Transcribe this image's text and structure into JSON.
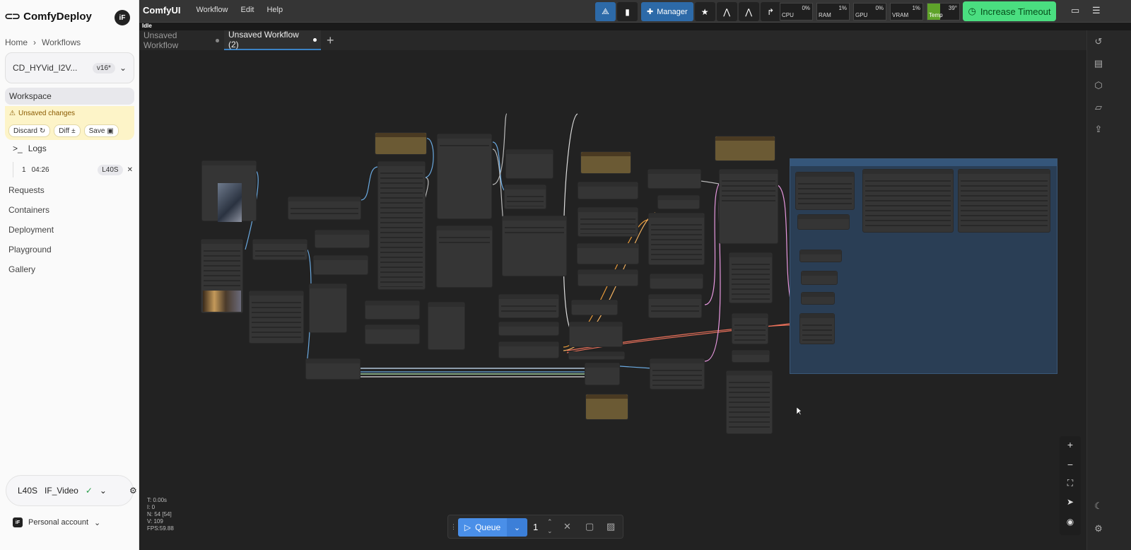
{
  "sidebar": {
    "brand": "ComfyDeploy",
    "avatar": "iF",
    "breadcrumb": [
      "Home",
      "Workflows"
    ],
    "workflow_name": "CD_HYVid_I2V...",
    "workflow_version": "v16*",
    "workspace_label": "Workspace",
    "unsaved_label": "Unsaved changes",
    "discard_label": "Discard",
    "diff_label": "Diff",
    "save_label": "Save",
    "logs_label": "Logs",
    "run": {
      "index": "1",
      "time": "04:26",
      "gpu": "L40S"
    },
    "nav": [
      "Requests",
      "Containers",
      "Deployment",
      "Playground",
      "Gallery"
    ],
    "machine": {
      "gpu": "L40S",
      "name": "IF_Video"
    },
    "account": {
      "avatar": "iF",
      "label": "Personal account"
    }
  },
  "topbar": {
    "app_name": "ComfyUI",
    "menu": [
      "Workflow",
      "Edit",
      "Help"
    ],
    "manager_label": "Manager",
    "stats": [
      {
        "label": "CPU",
        "value": "0%",
        "fill": 0
      },
      {
        "label": "RAM",
        "value": "1%",
        "fill": 1
      },
      {
        "label": "GPU",
        "value": "0%",
        "fill": 0
      },
      {
        "label": "VRAM",
        "value": "1%",
        "fill": 1
      },
      {
        "label": "Temp",
        "value": "39°",
        "fill": 39
      }
    ],
    "timeout_label": "Increase Timeout",
    "status": "Idle"
  },
  "tabs": [
    {
      "label": "Unsaved Workflow",
      "active": false
    },
    {
      "label": "Unsaved Workflow (2)",
      "active": true
    }
  ],
  "canvas": {
    "stats": [
      "T: 0.00s",
      "I: 0",
      "N: 54 [54]",
      "V: 109",
      "FPS:59.88"
    ]
  },
  "queue": {
    "label": "Queue",
    "count": "1"
  },
  "colors": {
    "accent": "#2d6aa8",
    "timeout": "#4ade80",
    "group": "#2a3e55",
    "queue": "#4a8fe8"
  }
}
